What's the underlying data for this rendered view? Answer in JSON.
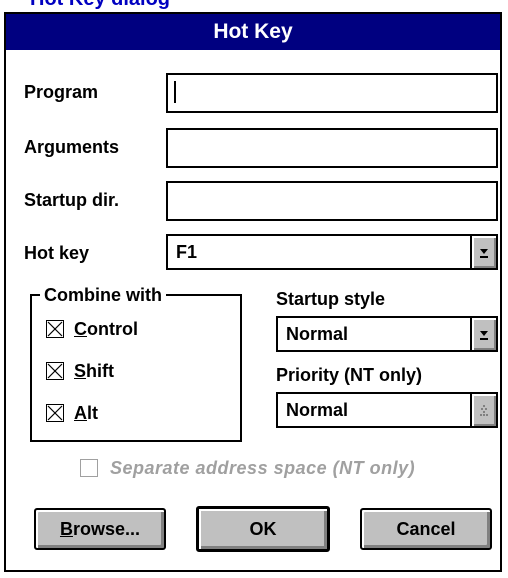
{
  "background_fragment": "Hot Key dialog",
  "dialog": {
    "title": "Hot Key",
    "fields": {
      "program": {
        "label": "Program",
        "value": ""
      },
      "arguments": {
        "label": "Arguments",
        "value": ""
      },
      "startup_dir": {
        "label": "Startup dir.",
        "value": ""
      },
      "hot_key": {
        "label": "Hot key",
        "value": "F1"
      }
    },
    "combine_with": {
      "title": "Combine with",
      "control": {
        "label_rest": "ontrol",
        "accel": "C",
        "checked": true
      },
      "shift": {
        "label_rest": "hift",
        "accel": "S",
        "checked": true
      },
      "alt": {
        "label_rest": "lt",
        "accel": "A",
        "checked": true
      }
    },
    "startup_style": {
      "label": "Startup style",
      "value": "Normal"
    },
    "priority": {
      "label": "Priority (NT only)",
      "value": "Normal",
      "enabled": false
    },
    "separate_address": {
      "label": "Separate address space (NT only)",
      "checked": false,
      "enabled": false
    },
    "buttons": {
      "browse": {
        "accel": "B",
        "label_rest": "rowse..."
      },
      "ok": {
        "label": "OK"
      },
      "cancel": {
        "label": "Cancel"
      }
    },
    "icons": [
      "dropdown-arrow-icon",
      "disabled-dropdown-icon",
      "checkbox-cross-icon"
    ],
    "colors": {
      "titlebar": "#000080",
      "button_face": "#c0c0c0",
      "disabled_text": "#a0a0a0"
    }
  }
}
